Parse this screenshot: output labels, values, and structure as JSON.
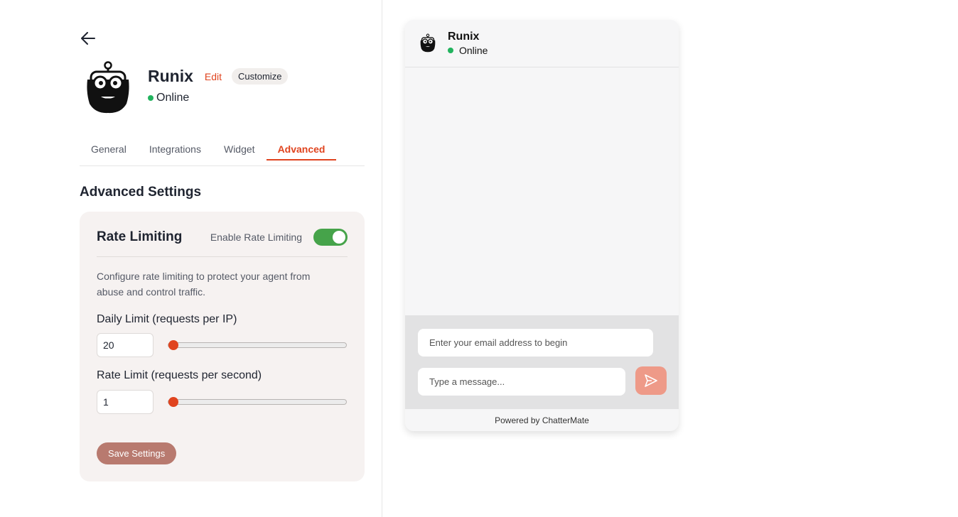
{
  "agent": {
    "name": "Runix",
    "edit_label": "Edit",
    "customize_label": "Customize",
    "status": "Online",
    "status_color": "#22b35e"
  },
  "tabs": [
    {
      "label": "General",
      "active": false
    },
    {
      "label": "Integrations",
      "active": false
    },
    {
      "label": "Widget",
      "active": false
    },
    {
      "label": "Advanced",
      "active": true
    }
  ],
  "advanced": {
    "title": "Advanced Settings",
    "rate_limiting": {
      "title": "Rate Limiting",
      "toggle_label": "Enable Rate Limiting",
      "enabled": true,
      "description": "Configure rate limiting to protect your agent from abuse and control traffic.",
      "daily": {
        "label": "Daily Limit (requests per IP)",
        "value": "20",
        "slider_fraction": 0.0
      },
      "rate": {
        "label": "Rate Limit (requests per second)",
        "value": "1",
        "slider_fraction": 0.0
      }
    },
    "save_label": "Save Settings"
  },
  "widget": {
    "name": "Runix",
    "status": "Online",
    "email_placeholder": "Enter your email address to begin",
    "message_placeholder": "Type a message...",
    "powered_by": "Powered by ChatterMate"
  },
  "colors": {
    "accent": "#e0441f",
    "toggle_on": "#46a34a",
    "save_button": "#b87a6f",
    "send_button": "#ee9a88"
  },
  "icons": {
    "back": "arrow-left-icon",
    "avatar": "bearded-robot-avatar",
    "send": "send-icon"
  }
}
